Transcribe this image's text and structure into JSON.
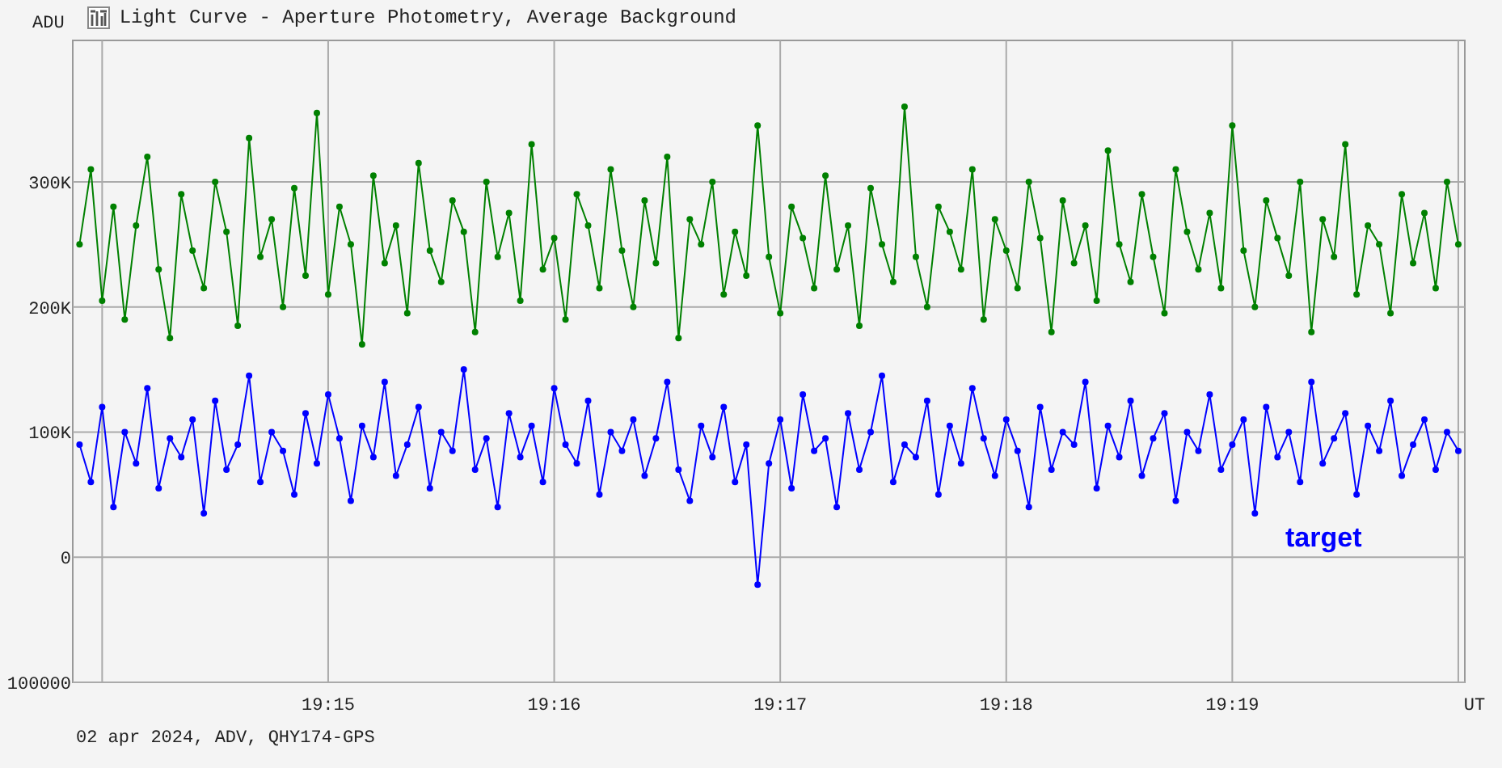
{
  "window": {
    "title": "Light Curve - Aperture Photometry, Average Background"
  },
  "chart_data": {
    "type": "line",
    "grid": true,
    "xlabel": "UT",
    "ylabel": "ADU",
    "ylim": [
      -100000,
      413000
    ],
    "yticks": [
      {
        "value": 300000,
        "label": "300K"
      },
      {
        "value": 200000,
        "label": "200K"
      },
      {
        "value": 100000,
        "label": "100K"
      },
      {
        "value": 0,
        "label": "0"
      },
      {
        "value": -100000,
        "label": "100000"
      }
    ],
    "categories": [
      null,
      null,
      null,
      null,
      null,
      null,
      null,
      null,
      null,
      null,
      null,
      null,
      null,
      null,
      null,
      null,
      null,
      null,
      null,
      null,
      null,
      null,
      "19:15",
      null,
      null,
      null,
      null,
      null,
      null,
      null,
      null,
      null,
      null,
      null,
      null,
      null,
      null,
      null,
      null,
      null,
      null,
      null,
      "19:16",
      null,
      null,
      null,
      null,
      null,
      null,
      null,
      null,
      null,
      null,
      null,
      null,
      null,
      null,
      null,
      null,
      null,
      null,
      null,
      "19:17",
      null,
      null,
      null,
      null,
      null,
      null,
      null,
      null,
      null,
      null,
      null,
      null,
      null,
      null,
      null,
      null,
      null,
      null,
      null,
      "19:18",
      null,
      null,
      null,
      null,
      null,
      null,
      null,
      null,
      null,
      null,
      null,
      null,
      null,
      null,
      null,
      null,
      null,
      null,
      null,
      "19:19",
      null,
      null,
      null,
      null,
      null,
      null,
      null,
      null,
      null,
      null,
      null,
      null,
      null,
      null,
      null,
      null,
      null,
      null,
      null,
      null
    ],
    "series": [
      {
        "color": "#008000",
        "marker": "circle",
        "values": [
          250000,
          310000,
          205000,
          280000,
          190000,
          265000,
          320000,
          230000,
          175000,
          290000,
          245000,
          215000,
          300000,
          260000,
          185000,
          335000,
          240000,
          270000,
          200000,
          295000,
          225000,
          355000,
          210000,
          280000,
          250000,
          170000,
          305000,
          235000,
          265000,
          195000,
          315000,
          245000,
          220000,
          285000,
          260000,
          180000,
          300000,
          240000,
          275000,
          205000,
          330000,
          230000,
          255000,
          190000,
          290000,
          265000,
          215000,
          310000,
          245000,
          200000,
          285000,
          235000,
          320000,
          175000,
          270000,
          250000,
          300000,
          210000,
          260000,
          225000,
          345000,
          240000,
          195000,
          280000,
          255000,
          215000,
          305000,
          230000,
          265000,
          185000,
          295000,
          250000,
          220000,
          360000,
          240000,
          200000,
          280000,
          260000,
          230000,
          310000,
          190000,
          270000,
          245000,
          215000,
          300000,
          255000,
          180000,
          285000,
          235000,
          265000,
          205000,
          325000,
          250000,
          220000,
          290000,
          240000,
          195000,
          310000,
          260000,
          230000,
          275000,
          215000,
          345000,
          245000,
          200000,
          285000,
          255000,
          225000,
          300000,
          180000,
          270000,
          240000,
          330000,
          210000,
          265000,
          250000,
          195000,
          290000,
          235000,
          275000,
          215000,
          300000,
          250000
        ]
      },
      {
        "name": "target",
        "color": "#0000ff",
        "marker": "circle",
        "values": [
          90000,
          60000,
          120000,
          40000,
          100000,
          75000,
          135000,
          55000,
          95000,
          80000,
          110000,
          35000,
          125000,
          70000,
          90000,
          145000,
          60000,
          100000,
          85000,
          50000,
          115000,
          75000,
          130000,
          95000,
          45000,
          105000,
          80000,
          140000,
          65000,
          90000,
          120000,
          55000,
          100000,
          85000,
          150000,
          70000,
          95000,
          40000,
          115000,
          80000,
          105000,
          60000,
          135000,
          90000,
          75000,
          125000,
          50000,
          100000,
          85000,
          110000,
          65000,
          95000,
          140000,
          70000,
          45000,
          105000,
          80000,
          120000,
          60000,
          90000,
          -22000,
          75000,
          110000,
          55000,
          130000,
          85000,
          95000,
          40000,
          115000,
          70000,
          100000,
          145000,
          60000,
          90000,
          80000,
          125000,
          50000,
          105000,
          75000,
          135000,
          95000,
          65000,
          110000,
          85000,
          40000,
          120000,
          70000,
          100000,
          90000,
          140000,
          55000,
          105000,
          80000,
          125000,
          65000,
          95000,
          115000,
          45000,
          100000,
          85000,
          130000,
          70000,
          90000,
          110000,
          35000,
          120000,
          80000,
          100000,
          60000,
          140000,
          75000,
          95000,
          115000,
          50000,
          105000,
          85000,
          125000,
          65000,
          90000,
          110000,
          70000,
          100000,
          85000
        ]
      }
    ]
  },
  "footer": "02 apr 2024, ADV, QHY174-GPS"
}
